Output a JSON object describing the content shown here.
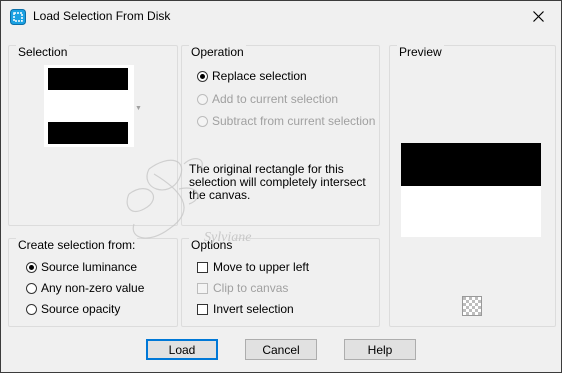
{
  "window": {
    "title": "Load Selection From Disk"
  },
  "selection": {
    "title": "Selection"
  },
  "operation": {
    "title": "Operation",
    "options": [
      {
        "label": "Replace selection",
        "checked": true,
        "disabled": false
      },
      {
        "label": "Add to current selection",
        "checked": false,
        "disabled": true
      },
      {
        "label": "Subtract from current selection",
        "checked": false,
        "disabled": true
      }
    ],
    "info": "The original rectangle for this selection will completely intersect the canvas."
  },
  "preview": {
    "title": "Preview"
  },
  "create_from": {
    "title": "Create selection from:",
    "options": [
      {
        "label": "Source luminance",
        "checked": true
      },
      {
        "label": "Any non-zero value",
        "checked": false
      },
      {
        "label": "Source opacity",
        "checked": false
      }
    ]
  },
  "options": {
    "title": "Options",
    "items": [
      {
        "label": "Move to upper left",
        "checked": false,
        "disabled": false
      },
      {
        "label": "Clip to canvas",
        "checked": false,
        "disabled": true
      },
      {
        "label": "Invert selection",
        "checked": false,
        "disabled": false
      }
    ]
  },
  "buttons": {
    "load": "Load",
    "cancel": "Cancel",
    "help": "Help"
  },
  "watermark": {
    "text": "Sylviane"
  },
  "colors": {
    "accent": "#0078d7",
    "icon": "#1ba1e2"
  },
  "icons": [
    "app-icon",
    "close-icon",
    "checker-icon"
  ]
}
